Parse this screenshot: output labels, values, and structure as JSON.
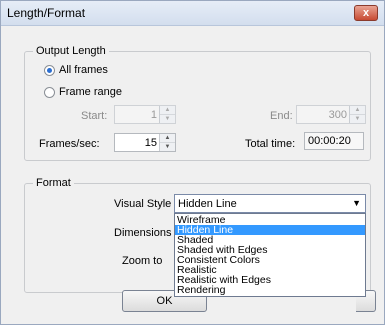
{
  "window": {
    "title": "Length/Format",
    "close_label": "x"
  },
  "output_length": {
    "group_label": "Output Length",
    "all_frames_label": "All frames",
    "frame_range_label": "Frame range",
    "start_label": "Start:",
    "start_value": "1",
    "end_label": "End:",
    "end_value": "300",
    "fps_label": "Frames/sec:",
    "fps_value": "15",
    "total_time_label": "Total time:",
    "total_time_value": "00:00:20"
  },
  "format": {
    "group_label": "Format",
    "visual_style_label": "Visual Style",
    "visual_style_value": "Hidden Line",
    "dimensions_label": "Dimensions",
    "zoom_label": "Zoom to",
    "options": [
      "Wireframe",
      "Hidden Line",
      "Shaded",
      "Shaded with Edges",
      "Consistent Colors",
      "Realistic",
      "Realistic with Edges",
      "Rendering"
    ]
  },
  "buttons": {
    "ok_label": "OK"
  }
}
